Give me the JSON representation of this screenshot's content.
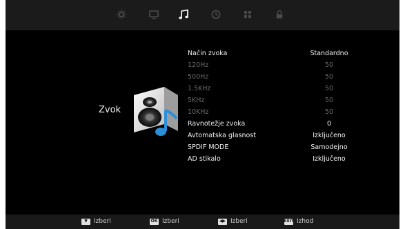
{
  "panel": {
    "title": "Zvok"
  },
  "tabs": [
    {
      "icon": "picture-settings-icon"
    },
    {
      "icon": "monitor-icon"
    },
    {
      "icon": "music-note-icon",
      "active": true
    },
    {
      "icon": "clock-icon"
    },
    {
      "icon": "grid-icon"
    },
    {
      "icon": "lock-icon"
    }
  ],
  "settings": [
    {
      "label": "Način zvoka",
      "value": "Standardno",
      "enabled": true
    },
    {
      "label": "120Hz",
      "value": "50",
      "enabled": false
    },
    {
      "label": "500Hz",
      "value": "50",
      "enabled": false
    },
    {
      "label": "1.5KHz",
      "value": "50",
      "enabled": false
    },
    {
      "label": "5KHz",
      "value": "50",
      "enabled": false
    },
    {
      "label": "10KHz",
      "value": "50",
      "enabled": false
    },
    {
      "label": "Ravnotežje zvoka",
      "value": "0",
      "enabled": true
    },
    {
      "label": "Avtomatska glasnost",
      "value": "Izključeno",
      "enabled": true
    },
    {
      "label": "SPDIF MODE",
      "value": "Samodejno",
      "enabled": true
    },
    {
      "label": "AD stikalo",
      "value": "Izključeno",
      "enabled": true
    }
  ],
  "footer": [
    {
      "key": "▼",
      "label": "Izberi",
      "icon": "down-arrow-key-icon"
    },
    {
      "key": "OK",
      "label": "Izberi",
      "icon": "ok-key-icon"
    },
    {
      "key": "◀▶",
      "label": "Izberi",
      "icon": "left-right-key-icon"
    },
    {
      "key": "EXIT",
      "label": "Izhod",
      "icon": "exit-key-icon"
    }
  ],
  "colors": {
    "background": "#000000",
    "text": "#f2f2f2",
    "disabled_text": "#6b6b6b",
    "accent_blue": "#2a8fd8"
  }
}
